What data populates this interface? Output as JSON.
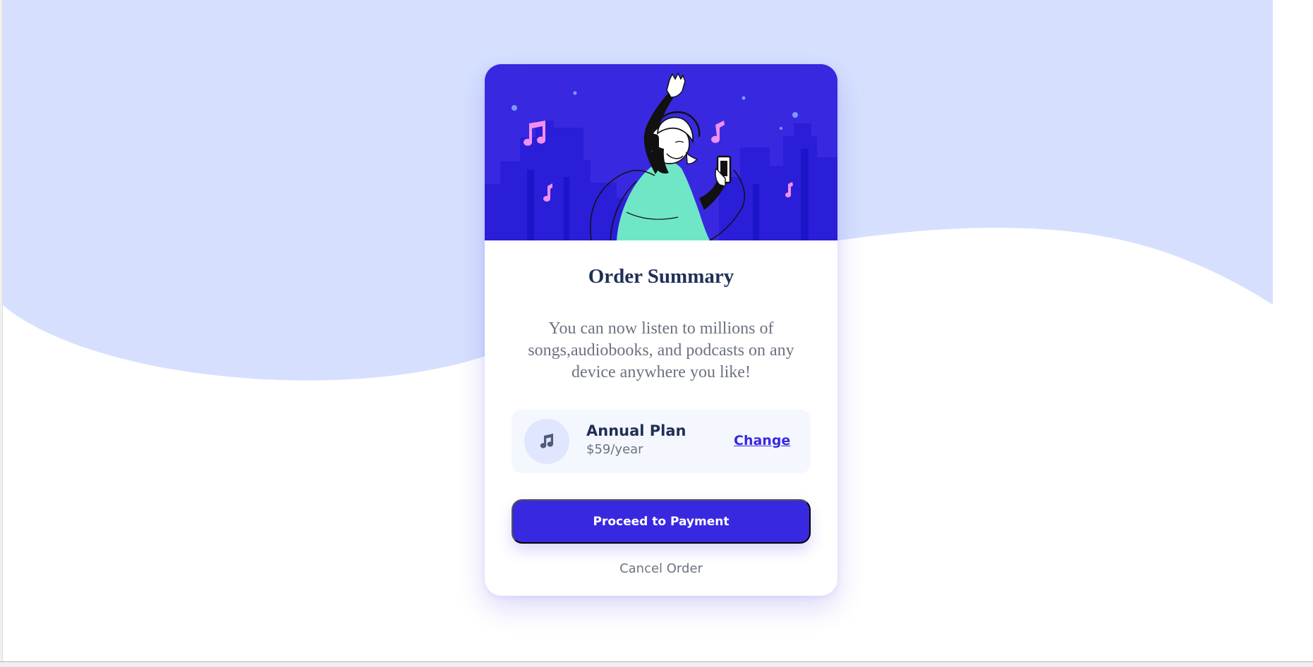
{
  "colors": {
    "page_background": "#ffffff",
    "wave_background": "#d6e0fe",
    "primary": "#3829e0",
    "dark_text": "#1f2f56",
    "muted_text": "#6b7280",
    "plan_background": "#f5f7ff",
    "icon_background": "#dfe6fd",
    "hero_accent": "#6fe7c7"
  },
  "hero": {
    "illustration_name": "person-dancing-with-headphones-illustration"
  },
  "card": {
    "title": "Order Summary",
    "description": "You can now listen to millions of songs,audiobooks, and podcasts on any device anywhere you like!",
    "plan": {
      "icon": "music-note-icon",
      "name": "Annual Plan",
      "price": "$59/year",
      "change_label": "Change"
    },
    "primary_button_label": "Proceed to Payment",
    "secondary_link_label": "Cancel Order"
  }
}
